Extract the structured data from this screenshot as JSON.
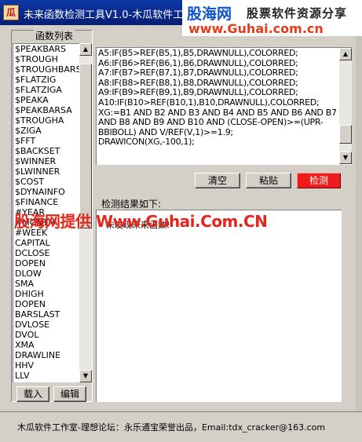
{
  "window": {
    "title": "未来函数检测工具V1.0-木瓜软件工作室",
    "icon_glyph": "瓜"
  },
  "watermark_banner": {
    "brand": "股海网",
    "tagline": "股票软件资源分享",
    "url": "www.Guhai.com.cn"
  },
  "function_list": {
    "title": "函数列表",
    "items": [
      "$PEAKBARS",
      "$TROUGH",
      "$TROUGHBARS",
      "$FLATZIG",
      "$FLATZIGA",
      "$PEAKA",
      "$PEAKBARSA",
      "$TROUGHA",
      "$ZIGA",
      "$FFT",
      "$BACKSET",
      "$WINNER",
      "$LWINNER",
      "$COST",
      "$DYNAINFO",
      "$FINANCE",
      "#YEAR",
      "#MONTH",
      "#WEEK",
      "CAPITAL",
      "DCLOSE",
      "DOPEN",
      "DLOW",
      "SMA",
      "DHIGH",
      "DOPEN",
      "BARSLAST",
      "DVLOSE",
      "DVOL",
      "XMA",
      "DRAWLINE",
      "HHV",
      "LLV"
    ],
    "load_label": "载入",
    "edit_label": "编辑"
  },
  "formula": {
    "text": "A5:IF(B5>REF(B5,1),B5,DRAWNULL),COLORRED;\nA6:IF(B6>REF(B6,1),B6,DRAWNULL),COLORRED;\nA7:IF(B7>REF(B7,1),B7,DRAWNULL),COLORRED;\nA8:IF(B8>REF(B8,1),B8,DRAWNULL),COLORRED;\nA9:IF(B9>REF(B9,1),B9,DRAWNULL),COLORRED;\nA10:IF(B10>REF(B10,1),B10,DRAWNULL),COLORRED;\nXG:=B1 AND B2 AND B3 AND B4 AND B5 AND B6 AND B7 AND B8 AND B9 AND B10 AND (CLOSE-OPEN)>=(UPR-BBIBOLL) AND V/REF(V,1)>=1.9;\nDRAWICON(XG,-100,1);"
  },
  "toolbar": {
    "clear_label": "清空",
    "paste_label": "粘贴",
    "check_label": "检测"
  },
  "result": {
    "label": "检测结果如下:",
    "text": "未发现未来函数!"
  },
  "watermark_overlay": {
    "text": "股海网提供 Www.Guhai.Com.CN"
  },
  "status_bar": {
    "text": "木瓜软件工作室-理想论坛：永乐通宝荣誉出品，Email:tdx_cracker@163.com"
  },
  "colors": {
    "titlebar": "#0a2a8e",
    "check_button": "#ee1b1b",
    "watermark_red": "#e5261c",
    "watermark_blue": "#0e53c9"
  }
}
